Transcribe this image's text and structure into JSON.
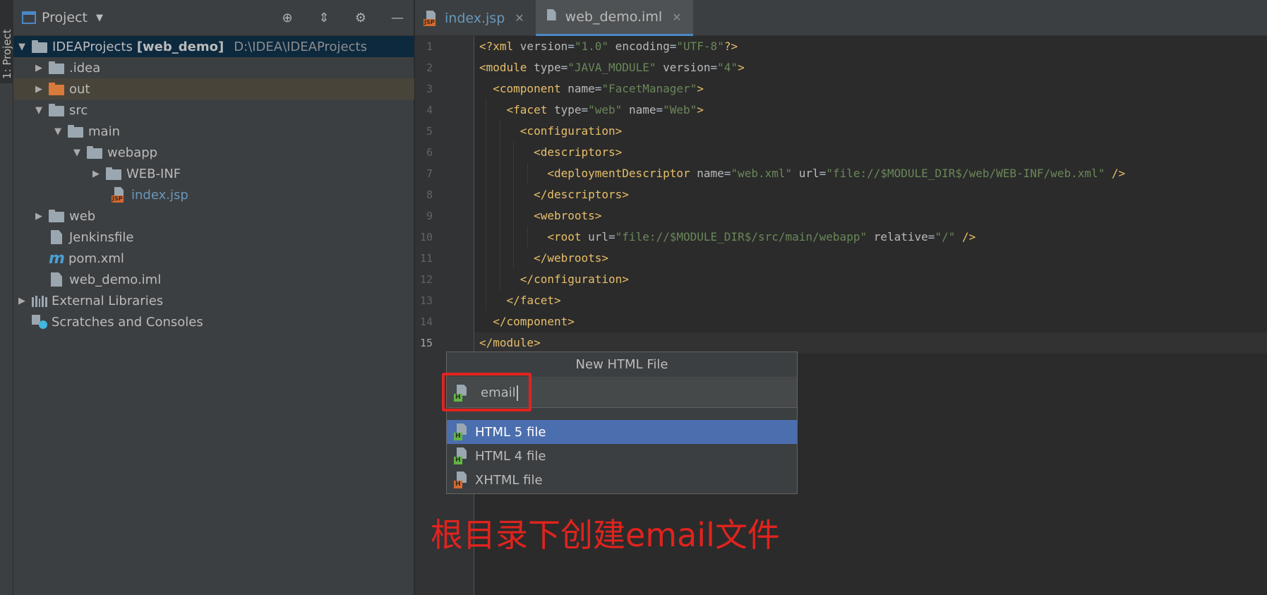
{
  "sidebar_stripe": {
    "label": "1: Project"
  },
  "project_panel": {
    "title": "Project",
    "tools": [
      "locate-icon",
      "collapse-icon",
      "gear-icon",
      "minimize-icon"
    ],
    "tree": [
      {
        "name": "IDEAProjects",
        "bold": "[web_demo]",
        "path": "D:\\IDEA\\IDEAProjects"
      },
      {
        "name": ".idea"
      },
      {
        "name": "out"
      },
      {
        "name": "src"
      },
      {
        "name": "main"
      },
      {
        "name": "webapp"
      },
      {
        "name": "WEB-INF"
      },
      {
        "name": "index.jsp"
      },
      {
        "name": "web"
      },
      {
        "name": "Jenkinsfile"
      },
      {
        "name": "pom.xml"
      },
      {
        "name": "web_demo.iml"
      },
      {
        "name": "External Libraries"
      },
      {
        "name": "Scratches and Consoles"
      }
    ]
  },
  "editor": {
    "tabs": [
      {
        "label": "index.jsp",
        "tag": "JSP"
      },
      {
        "label": "web_demo.iml"
      }
    ],
    "line_numbers": [
      "1",
      "2",
      "3",
      "4",
      "5",
      "6",
      "7",
      "8",
      "9",
      "10",
      "11",
      "12",
      "13",
      "14",
      "15"
    ],
    "lines": [
      [
        [
          "t-tag",
          "<?xml "
        ],
        [
          "t-attr",
          "version"
        ],
        [
          "t-txt",
          "="
        ],
        [
          "t-val",
          "\"1.0\""
        ],
        [
          "t-attr",
          " encoding"
        ],
        [
          "t-txt",
          "="
        ],
        [
          "t-val",
          "\"UTF-8\""
        ],
        [
          "t-tag",
          "?>"
        ]
      ],
      [
        [
          "t-tag",
          "<module "
        ],
        [
          "t-attr",
          "type"
        ],
        [
          "t-txt",
          "="
        ],
        [
          "t-val",
          "\"JAVA_MODULE\""
        ],
        [
          "t-attr",
          " version"
        ],
        [
          "t-txt",
          "="
        ],
        [
          "t-val",
          "\"4\""
        ],
        [
          "t-tag",
          ">"
        ]
      ],
      [
        [
          "t-txt",
          "  "
        ],
        [
          "t-tag",
          "<component "
        ],
        [
          "t-attr",
          "name"
        ],
        [
          "t-txt",
          "="
        ],
        [
          "t-val",
          "\"FacetManager\""
        ],
        [
          "t-tag",
          ">"
        ]
      ],
      [
        [
          "t-txt",
          "    "
        ],
        [
          "t-tag",
          "<facet "
        ],
        [
          "t-attr",
          "type"
        ],
        [
          "t-txt",
          "="
        ],
        [
          "t-val",
          "\"web\""
        ],
        [
          "t-attr",
          " name"
        ],
        [
          "t-txt",
          "="
        ],
        [
          "t-val",
          "\"Web\""
        ],
        [
          "t-tag",
          ">"
        ]
      ],
      [
        [
          "t-txt",
          "      "
        ],
        [
          "t-tag",
          "<configuration>"
        ]
      ],
      [
        [
          "t-txt",
          "        "
        ],
        [
          "t-tag",
          "<descriptors>"
        ]
      ],
      [
        [
          "t-txt",
          "          "
        ],
        [
          "t-tag",
          "<deploymentDescriptor "
        ],
        [
          "t-attr",
          "name"
        ],
        [
          "t-txt",
          "="
        ],
        [
          "t-val",
          "\"web.xml\""
        ],
        [
          "t-attr",
          " url"
        ],
        [
          "t-txt",
          "="
        ],
        [
          "t-val",
          "\"file://$MODULE_DIR$/web/WEB-INF/web.xml\""
        ],
        [
          "t-tag",
          " />"
        ]
      ],
      [
        [
          "t-txt",
          "        "
        ],
        [
          "t-tag",
          "</descriptors>"
        ]
      ],
      [
        [
          "t-txt",
          "        "
        ],
        [
          "t-tag",
          "<webroots>"
        ]
      ],
      [
        [
          "t-txt",
          "          "
        ],
        [
          "t-tag",
          "<root "
        ],
        [
          "t-attr",
          "url"
        ],
        [
          "t-txt",
          "="
        ],
        [
          "t-val",
          "\"file://$MODULE_DIR$/src/main/webapp\""
        ],
        [
          "t-attr",
          " relative"
        ],
        [
          "t-txt",
          "="
        ],
        [
          "t-val",
          "\"/\""
        ],
        [
          "t-tag",
          " />"
        ]
      ],
      [
        [
          "t-txt",
          "        "
        ],
        [
          "t-tag",
          "</webroots>"
        ]
      ],
      [
        [
          "t-txt",
          "      "
        ],
        [
          "t-tag",
          "</configuration>"
        ]
      ],
      [
        [
          "t-txt",
          "    "
        ],
        [
          "t-tag",
          "</facet>"
        ]
      ],
      [
        [
          "t-txt",
          "  "
        ],
        [
          "t-tag",
          "</component>"
        ]
      ],
      [
        [
          "t-tag",
          "</module>"
        ]
      ]
    ]
  },
  "popup": {
    "title": "New HTML File",
    "input_value": "email",
    "items": [
      {
        "label": "HTML 5 file",
        "tag": "H",
        "tag_color": "#62b543"
      },
      {
        "label": "HTML 4 file",
        "tag": "H",
        "tag_color": "#62b543"
      },
      {
        "label": "XHTML file",
        "tag": "H",
        "tag_color": "#d36a2f"
      }
    ]
  },
  "annotation": "根目录下创建email文件",
  "colors": {
    "accent": "#4b6eaf",
    "annotation": "#e0231e"
  }
}
